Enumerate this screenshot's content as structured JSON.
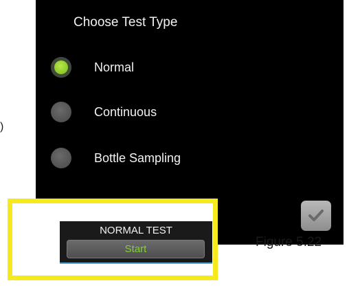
{
  "screen": {
    "title": "Choose Test Type",
    "options": [
      {
        "label": "Normal",
        "selected": true
      },
      {
        "label": "Continuous",
        "selected": false
      },
      {
        "label": "Bottle Sampling",
        "selected": false
      }
    ],
    "confirm_icon": "checkmark-icon"
  },
  "panel": {
    "title": "NORMAL TEST",
    "start_label": "Start"
  },
  "caption": "Figure 5.22",
  "side_mark": ")",
  "colors": {
    "screen_bg": "#000000",
    "selected_radio": "#8cc82a",
    "highlight_border": "#f6ea1e",
    "start_text": "#7ed32b"
  }
}
